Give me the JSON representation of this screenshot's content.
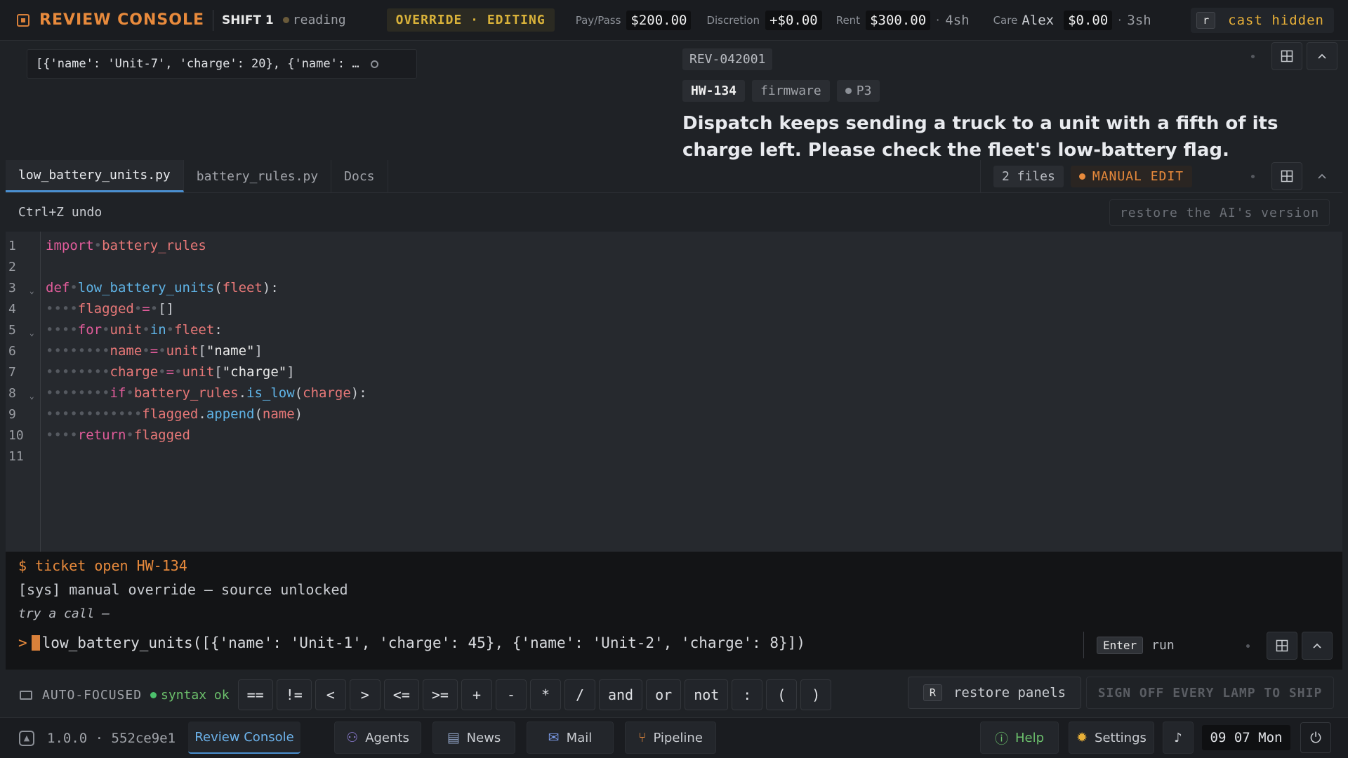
{
  "topbar": {
    "title": "REVIEW CONSOLE",
    "shift": "SHIFT 1",
    "status": "reading",
    "mode": "OVERRIDE · EDITING",
    "pay_label": "Pay/Pass",
    "pay_value": "$200.00",
    "discretion_label": "Discretion",
    "discretion_value": "+$0.00",
    "rent_label": "Rent",
    "rent_value": "$300.00",
    "rent_sep": "·",
    "rent_extra": "4sh",
    "care_label": "Care",
    "care_name": "Alex",
    "care_value": "$0.00",
    "care_sep": "·",
    "care_extra": "3sh",
    "cast_key": "r",
    "cast_label": "cast hidden"
  },
  "chip": {
    "text": "[{'name': 'Unit-7', 'charge': 20}, {'name': …"
  },
  "ticket": {
    "id": "REV-042001",
    "tag_hw": "HW-134",
    "tag_area": "firmware",
    "tag_priority": "P3",
    "description": "Dispatch keeps sending a truck to a unit with a fifth of its charge left. Please check the fleet's low-battery flag."
  },
  "tabs": [
    {
      "label": "low_battery_units.py"
    },
    {
      "label": "battery_rules.py"
    },
    {
      "label": "Docs"
    }
  ],
  "files_badge": "2 files",
  "manual_badge": "MANUAL EDIT",
  "editor": {
    "undo_hint": "Ctrl+Z undo",
    "restore_label": "restore the AI's version",
    "line_numbers": [
      "1",
      "2",
      "3",
      "4",
      "5",
      "6",
      "7",
      "8",
      "9",
      "10",
      "11"
    ]
  },
  "terminal": {
    "line1": "$ ticket open HW-134",
    "line2": "[sys] manual override — source unlocked",
    "line3": "try a call —",
    "prompt": ">",
    "command": "low_battery_units([{'name': 'Unit-1', 'charge': 45}, {'name': 'Unit-2', 'charge': 8}])",
    "enter_key": "Enter",
    "enter_label": "run"
  },
  "tokenbar": {
    "auto_label": "AUTO-FOCUSED",
    "syntax_label": "syntax ok",
    "tokens": [
      "==",
      "!=",
      "<",
      ">",
      "<=",
      ">=",
      "+",
      "-",
      "*",
      "/",
      "and",
      "or",
      "not",
      ":",
      "(",
      ")"
    ],
    "restore_key": "R",
    "restore_label": "restore panels",
    "signoff_label": "SIGN OFF EVERY LAMP TO SHIP"
  },
  "taskbar": {
    "version": "1.0.0 · 552ce9e1",
    "apps": [
      {
        "label": "Review Console"
      },
      {
        "label": "Agents"
      },
      {
        "label": "News"
      },
      {
        "label": "Mail"
      },
      {
        "label": "Pipeline"
      }
    ],
    "help_label": "Help",
    "settings_label": "Settings",
    "clock": "09 07 Mon"
  },
  "colors": {
    "accent_orange": "#e88a3c",
    "mode_yellow": "#d9b23a",
    "link_blue": "#4a8fd0",
    "ok_green": "#4cc06c",
    "keyword": "#e05c9a",
    "function": "#5fb3e6",
    "variable": "#e87878"
  }
}
